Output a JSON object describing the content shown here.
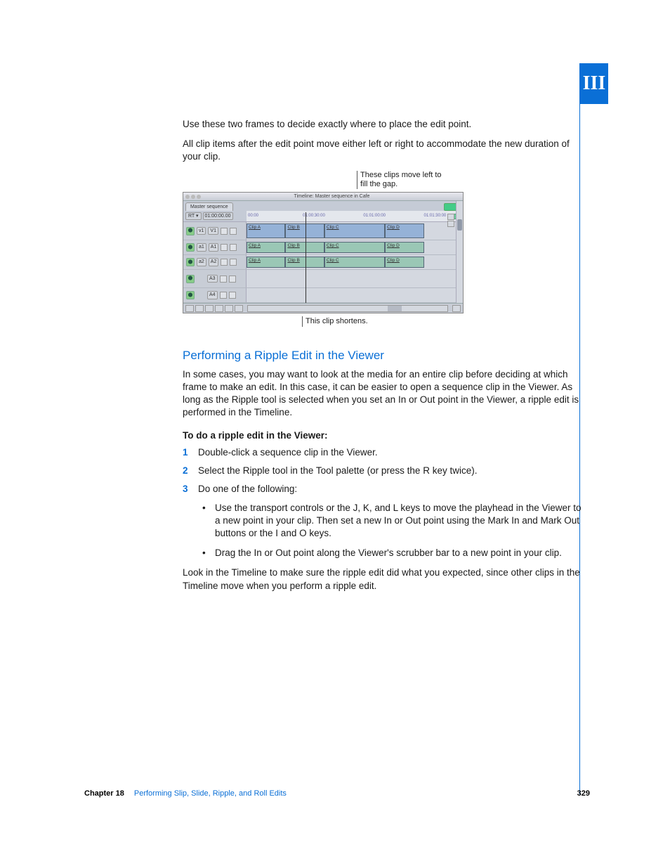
{
  "section_tab": "III",
  "body": {
    "p1": "Use these two frames to decide exactly where to place the edit point.",
    "p2": "All clip items after the edit point move either left or right to accommodate the new duration of your clip."
  },
  "figure": {
    "callout_top": "These clips move left to fill the gap.",
    "callout_bottom": "This clip shortens.",
    "window_title": "Timeline: Master sequence in Cafe",
    "tab_label": "Master sequence",
    "rt_button": "RT ▾",
    "timecode": "01:00:00.00",
    "ruler": [
      "00:00",
      "01:00:30:00",
      "01:01:00:00",
      "01:01:30:00"
    ],
    "tracks": {
      "v1": {
        "src": "v1",
        "dst": "V1"
      },
      "a1": {
        "src": "a1",
        "dst": "A1"
      },
      "a2": {
        "src": "a2",
        "dst": "A2"
      },
      "a3": {
        "dst": "A3"
      },
      "a4": {
        "dst": "A4"
      }
    },
    "clips": [
      "Clip A",
      "Clip B",
      "Clip C",
      "Clip D"
    ]
  },
  "section": {
    "heading": "Performing a Ripple Edit in the Viewer",
    "intro": "In some cases, you may want to look at the media for an entire clip before deciding at which frame to make an edit. In this case, it can be easier to open a sequence clip in the Viewer. As long as the Ripple tool is selected when you set an In or Out point in the Viewer, a ripple edit is performed in the Timeline.",
    "instr_head": "To do a ripple edit in the Viewer:",
    "steps": {
      "s1": "Double-click a sequence clip in the Viewer.",
      "s2": "Select the Ripple tool in the Tool palette (or press the R key twice).",
      "s3": "Do one of the following:"
    },
    "bullets": {
      "b1": "Use the transport controls or the J, K, and L keys to move the playhead in the Viewer to a new point in your clip. Then set a new In or Out point using the Mark In and Mark Out buttons or the I and O keys.",
      "b2": "Drag the In or Out point along the Viewer's scrubber bar to a new point in your clip."
    },
    "closing": "Look in the Timeline to make sure the ripple edit did what you expected, since other clips in the Timeline move when you perform a ripple edit."
  },
  "footer": {
    "chapter_label": "Chapter 18",
    "chapter_title": "Performing Slip, Slide, Ripple, and Roll Edits",
    "page": "329"
  }
}
